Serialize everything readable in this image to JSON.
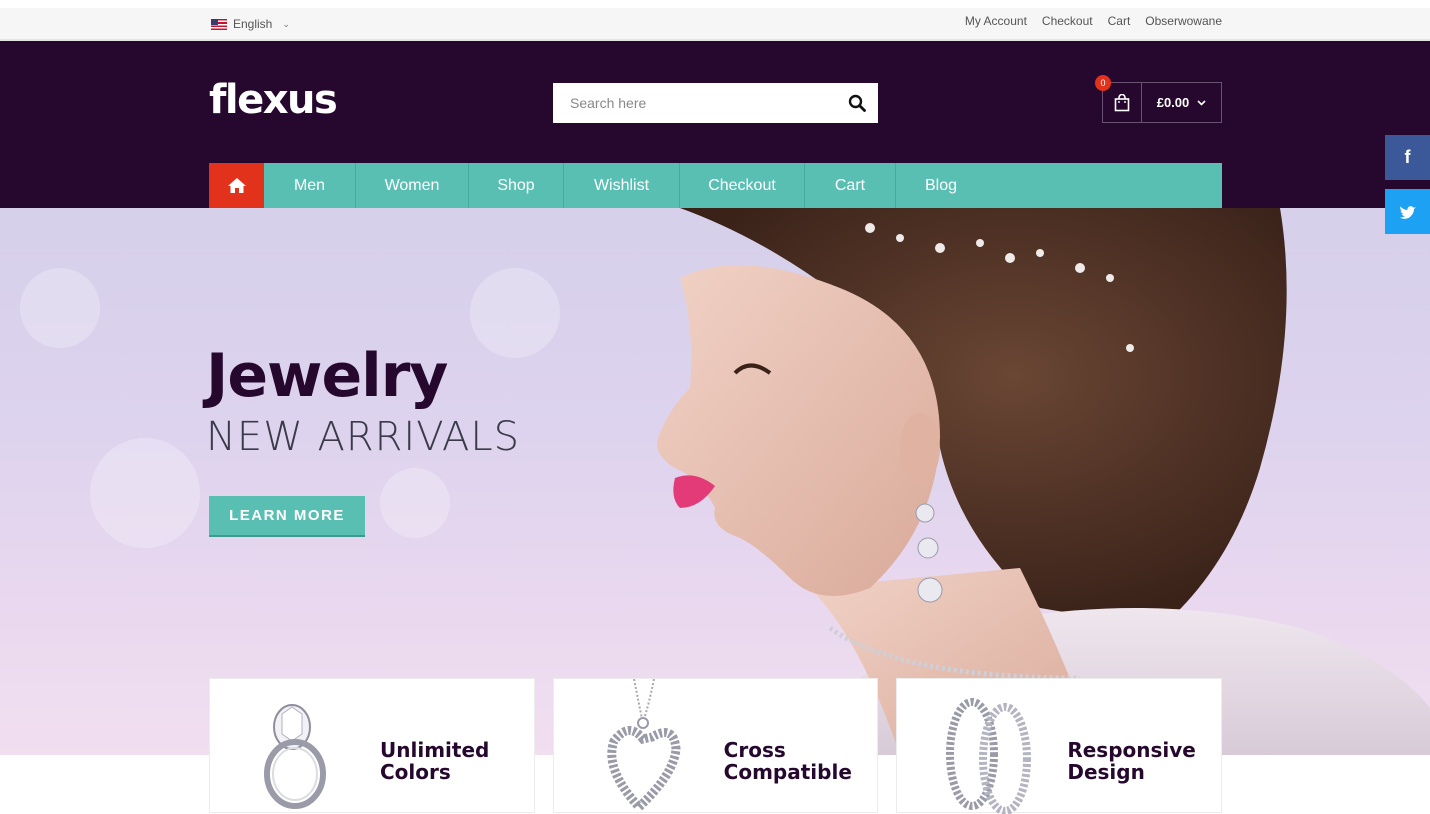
{
  "language": {
    "label": "English"
  },
  "util_links": [
    "My Account",
    "Checkout",
    "Cart",
    "Obserwowane"
  ],
  "brand": {
    "logo": "flexus"
  },
  "search": {
    "placeholder": "Search here"
  },
  "cart": {
    "count": "0",
    "total": "£0.00"
  },
  "nav": [
    "Men",
    "Women",
    "Shop",
    "Wishlist",
    "Checkout",
    "Cart",
    "Blog"
  ],
  "hero": {
    "title": "Jewelry",
    "subtitle": "NEW ARRIVALS",
    "cta": "LEARN MORE"
  },
  "social": {
    "facebook": "f",
    "twitter": "twitter-bird"
  },
  "features": [
    {
      "line1": "Unlimited",
      "line2": "Colors",
      "icon": "ring-icon"
    },
    {
      "line1": "Cross",
      "line2": "Compatible",
      "icon": "heart-pendant-icon"
    },
    {
      "line1": "Responsive",
      "line2": "Design",
      "icon": "hoop-earrings-icon"
    }
  ],
  "colors": {
    "header": "#26082e",
    "accent": "#5abfb3",
    "home": "#e2321b"
  }
}
